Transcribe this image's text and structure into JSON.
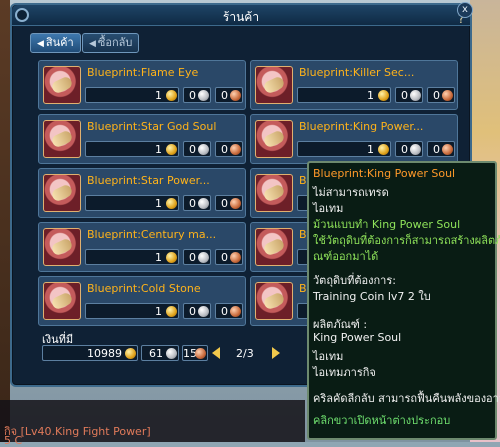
{
  "window": {
    "title": "ร้านค้า",
    "help": "?",
    "close": "x"
  },
  "tabs": [
    {
      "label": "สินค้า",
      "active": true
    },
    {
      "label": "ซื้อกลับ",
      "active": false
    }
  ],
  "items": [
    {
      "name": "Blueprint:Flame Eye",
      "gold": "1",
      "silver": "0",
      "copper": "0"
    },
    {
      "name": "Blueprint:Killer Sec...",
      "gold": "1",
      "silver": "0",
      "copper": "0"
    },
    {
      "name": "Blueprint:Star God Soul",
      "gold": "1",
      "silver": "0",
      "copper": "0"
    },
    {
      "name": "Blueprint:King Power...",
      "gold": "1",
      "silver": "0",
      "copper": "0"
    },
    {
      "name": "Blueprint:Star Power...",
      "gold": "1",
      "silver": "0",
      "copper": "0"
    },
    {
      "name": "Blue",
      "gold": "1",
      "silver": "0",
      "copper": "0"
    },
    {
      "name": "Blueprint:Century ma...",
      "gold": "1",
      "silver": "0",
      "copper": "0"
    },
    {
      "name": "Blue",
      "gold": "1",
      "silver": "0",
      "copper": "0"
    },
    {
      "name": "Blueprint:Cold Stone",
      "gold": "1",
      "silver": "0",
      "copper": "0"
    },
    {
      "name": "Blue",
      "gold": "1",
      "silver": "0",
      "copper": "0"
    }
  ],
  "money": {
    "label": "เงินที่มี",
    "gold": "10989",
    "silver": "61",
    "copper": "15"
  },
  "pager": {
    "text": "2/3"
  },
  "tooltip": {
    "title": "Blueprint:King Power Soul",
    "lines": [
      {
        "text": "ไม่สามารถเทรด",
        "color": "white"
      },
      {
        "text": "ไอเทม",
        "color": "white"
      },
      {
        "text": "ม้วนแบบทำ King Power Soul",
        "color": "green"
      },
      {
        "text": "ใช้วัตถุดิบที่ต้องการก็สามารถสร้างผลิตภั",
        "color": "green"
      },
      {
        "text": "ณฑ์ออกมาได้",
        "color": "green"
      },
      {
        "text": "วัตถุดิบที่ต้องการ:",
        "color": "white"
      },
      {
        "text": "Training Coin lv7 2 ใบ",
        "color": "white"
      },
      {
        "text": "ผลิตภัณฑ์ :",
        "color": "white"
      },
      {
        "text": "King Power Soul",
        "color": "white"
      },
      {
        "text": "ไอเทม",
        "color": "white"
      },
      {
        "text": "ไอเทมภารกิจ",
        "color": "white"
      },
      {
        "text": "คริลคัดลีกลับ สามารถฟื้นคืนพลังของอาวุธ",
        "color": "white"
      },
      {
        "text": "คลิกขวาเปิดหน้าต่างประกอบ",
        "color": "lgreen"
      }
    ]
  },
  "chat": {
    "line1": "กิจ [Lv40.King Fight Power]",
    "line2": "5 C"
  }
}
